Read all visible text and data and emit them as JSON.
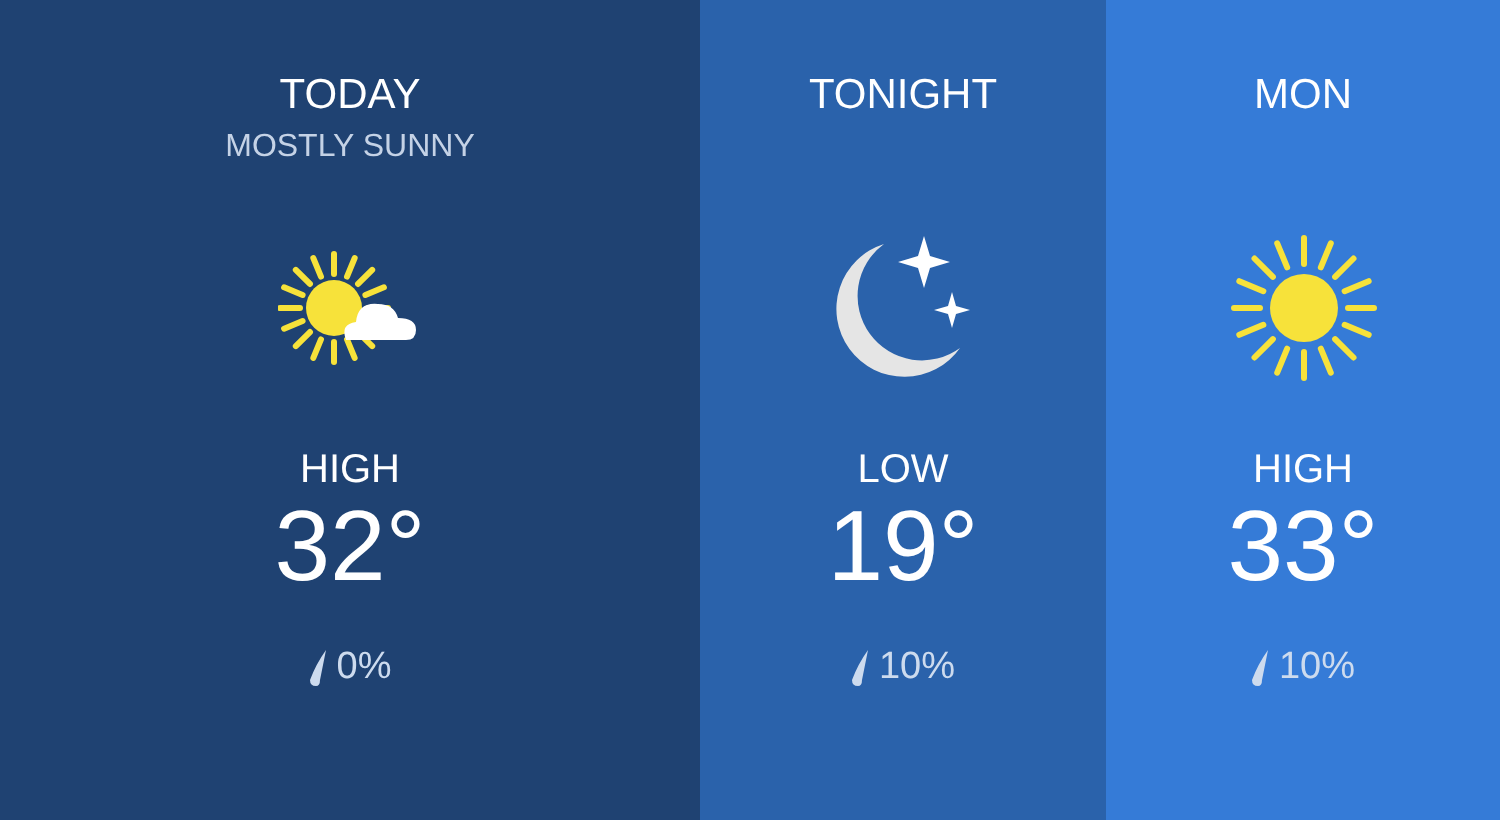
{
  "periods": [
    {
      "title": "TODAY",
      "subtitle": "MOSTLY SUNNY",
      "kind": "sun_cloud",
      "label": "HIGH",
      "temp": "32°",
      "precip": "0%",
      "color": "#1f4272"
    },
    {
      "title": "TONIGHT",
      "kind": "moon_stars",
      "label": "LOW",
      "temp": "19°",
      "precip": "10%",
      "color": "#2a62ab"
    },
    {
      "title": "MON",
      "kind": "sun",
      "label": "HIGH",
      "temp": "33°",
      "precip": "10%",
      "color": "#357bd7"
    }
  ]
}
